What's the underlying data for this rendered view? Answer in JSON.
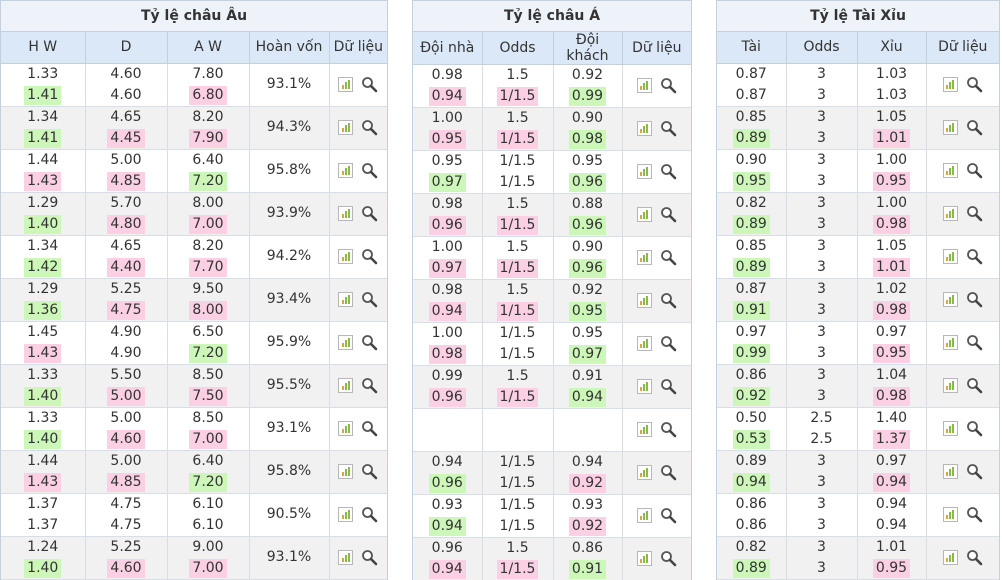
{
  "colors": {
    "up": "#ccf7b8",
    "down": "#fcd0e4",
    "header": "#dbe8f7",
    "alt_row": "#f1f1f1"
  },
  "icons": {
    "data": "bar-chart-icon",
    "detail": "magnifier-icon"
  },
  "europe": {
    "title": "Tỷ lệ châu Âu",
    "headers": [
      "H W",
      "D",
      "A W",
      "Hoàn vốn",
      "Dữ liệu"
    ],
    "rows": [
      {
        "hw": [
          "1.33",
          "1.41"
        ],
        "hw_t": [
          "",
          "up"
        ],
        "d": [
          "4.60",
          "4.60"
        ],
        "d_t": [
          "",
          ""
        ],
        "aw": [
          "7.80",
          "6.80"
        ],
        "aw_t": [
          "",
          "down"
        ],
        "ret": "93.1%"
      },
      {
        "hw": [
          "1.34",
          "1.41"
        ],
        "hw_t": [
          "",
          "up"
        ],
        "d": [
          "4.65",
          "4.45"
        ],
        "d_t": [
          "",
          "down"
        ],
        "aw": [
          "8.20",
          "7.90"
        ],
        "aw_t": [
          "",
          "down"
        ],
        "ret": "94.3%"
      },
      {
        "hw": [
          "1.44",
          "1.43"
        ],
        "hw_t": [
          "",
          "down"
        ],
        "d": [
          "5.00",
          "4.85"
        ],
        "d_t": [
          "",
          "down"
        ],
        "aw": [
          "6.40",
          "7.20"
        ],
        "aw_t": [
          "",
          "up"
        ],
        "ret": "95.8%"
      },
      {
        "hw": [
          "1.29",
          "1.40"
        ],
        "hw_t": [
          "",
          "up"
        ],
        "d": [
          "5.70",
          "4.80"
        ],
        "d_t": [
          "",
          "down"
        ],
        "aw": [
          "8.00",
          "7.00"
        ],
        "aw_t": [
          "",
          "down"
        ],
        "ret": "93.9%"
      },
      {
        "hw": [
          "1.34",
          "1.42"
        ],
        "hw_t": [
          "",
          "up"
        ],
        "d": [
          "4.65",
          "4.40"
        ],
        "d_t": [
          "",
          "down"
        ],
        "aw": [
          "8.20",
          "7.70"
        ],
        "aw_t": [
          "",
          "down"
        ],
        "ret": "94.2%"
      },
      {
        "hw": [
          "1.29",
          "1.36"
        ],
        "hw_t": [
          "",
          "up"
        ],
        "d": [
          "5.25",
          "4.75"
        ],
        "d_t": [
          "",
          "down"
        ],
        "aw": [
          "9.50",
          "8.00"
        ],
        "aw_t": [
          "",
          "down"
        ],
        "ret": "93.4%"
      },
      {
        "hw": [
          "1.45",
          "1.43"
        ],
        "hw_t": [
          "",
          "down"
        ],
        "d": [
          "4.90",
          "4.90"
        ],
        "d_t": [
          "",
          ""
        ],
        "aw": [
          "6.50",
          "7.20"
        ],
        "aw_t": [
          "",
          "up"
        ],
        "ret": "95.9%"
      },
      {
        "hw": [
          "1.33",
          "1.40"
        ],
        "hw_t": [
          "",
          "up"
        ],
        "d": [
          "5.50",
          "5.00"
        ],
        "d_t": [
          "",
          "down"
        ],
        "aw": [
          "8.50",
          "7.50"
        ],
        "aw_t": [
          "",
          "down"
        ],
        "ret": "95.5%"
      },
      {
        "hw": [
          "1.33",
          "1.40"
        ],
        "hw_t": [
          "",
          "up"
        ],
        "d": [
          "5.00",
          "4.60"
        ],
        "d_t": [
          "",
          "down"
        ],
        "aw": [
          "8.50",
          "7.00"
        ],
        "aw_t": [
          "",
          "down"
        ],
        "ret": "93.1%"
      },
      {
        "hw": [
          "1.44",
          "1.43"
        ],
        "hw_t": [
          "",
          "down"
        ],
        "d": [
          "5.00",
          "4.85"
        ],
        "d_t": [
          "",
          "down"
        ],
        "aw": [
          "6.40",
          "7.20"
        ],
        "aw_t": [
          "",
          "up"
        ],
        "ret": "95.8%"
      },
      {
        "hw": [
          "1.37",
          "1.37"
        ],
        "hw_t": [
          "",
          ""
        ],
        "d": [
          "4.75",
          "4.75"
        ],
        "d_t": [
          "",
          ""
        ],
        "aw": [
          "6.10",
          "6.10"
        ],
        "aw_t": [
          "",
          ""
        ],
        "ret": "90.5%"
      },
      {
        "hw": [
          "1.24",
          "1.40"
        ],
        "hw_t": [
          "",
          "up"
        ],
        "d": [
          "5.25",
          "4.60"
        ],
        "d_t": [
          "",
          "down"
        ],
        "aw": [
          "9.00",
          "7.00"
        ],
        "aw_t": [
          "",
          "down"
        ],
        "ret": "93.1%"
      }
    ]
  },
  "asia": {
    "title": "Tỷ lệ châu Á",
    "headers": [
      "Đội nhà",
      "Odds",
      "Đội khách",
      "Dữ liệu"
    ],
    "rows": [
      {
        "home": [
          "0.98",
          "0.94"
        ],
        "home_t": [
          "",
          "down"
        ],
        "odds": [
          "1.5",
          "1/1.5"
        ],
        "odds_t": [
          "",
          "down"
        ],
        "away": [
          "0.92",
          "0.99"
        ],
        "away_t": [
          "",
          "up"
        ]
      },
      {
        "home": [
          "1.00",
          "0.95"
        ],
        "home_t": [
          "",
          "down"
        ],
        "odds": [
          "1.5",
          "1/1.5"
        ],
        "odds_t": [
          "",
          "down"
        ],
        "away": [
          "0.90",
          "0.98"
        ],
        "away_t": [
          "",
          "up"
        ]
      },
      {
        "home": [
          "0.95",
          "0.97"
        ],
        "home_t": [
          "",
          "up"
        ],
        "odds": [
          "1/1.5",
          "1/1.5"
        ],
        "odds_t": [
          "",
          ""
        ],
        "away": [
          "0.95",
          "0.96"
        ],
        "away_t": [
          "",
          "up"
        ]
      },
      {
        "home": [
          "0.98",
          "0.96"
        ],
        "home_t": [
          "",
          "down"
        ],
        "odds": [
          "1.5",
          "1/1.5"
        ],
        "odds_t": [
          "",
          "down"
        ],
        "away": [
          "0.88",
          "0.96"
        ],
        "away_t": [
          "",
          "up"
        ]
      },
      {
        "home": [
          "1.00",
          "0.97"
        ],
        "home_t": [
          "",
          "down"
        ],
        "odds": [
          "1.5",
          "1/1.5"
        ],
        "odds_t": [
          "",
          "down"
        ],
        "away": [
          "0.90",
          "0.96"
        ],
        "away_t": [
          "",
          "up"
        ]
      },
      {
        "home": [
          "0.98",
          "0.94"
        ],
        "home_t": [
          "",
          "down"
        ],
        "odds": [
          "1.5",
          "1/1.5"
        ],
        "odds_t": [
          "",
          "down"
        ],
        "away": [
          "0.92",
          "0.95"
        ],
        "away_t": [
          "",
          "up"
        ]
      },
      {
        "home": [
          "1.00",
          "0.98"
        ],
        "home_t": [
          "",
          "down"
        ],
        "odds": [
          "1/1.5",
          "1/1.5"
        ],
        "odds_t": [
          "",
          ""
        ],
        "away": [
          "0.95",
          "0.97"
        ],
        "away_t": [
          "",
          "up"
        ]
      },
      {
        "home": [
          "0.99",
          "0.96"
        ],
        "home_t": [
          "",
          "down"
        ],
        "odds": [
          "1.5",
          "1/1.5"
        ],
        "odds_t": [
          "",
          "down"
        ],
        "away": [
          "0.91",
          "0.94"
        ],
        "away_t": [
          "",
          "up"
        ]
      },
      {
        "home": [
          "",
          ""
        ],
        "home_t": [
          "",
          ""
        ],
        "odds": [
          "",
          ""
        ],
        "odds_t": [
          "",
          ""
        ],
        "away": [
          "",
          ""
        ],
        "away_t": [
          "",
          ""
        ]
      },
      {
        "home": [
          "0.94",
          "0.96"
        ],
        "home_t": [
          "",
          "up"
        ],
        "odds": [
          "1/1.5",
          "1/1.5"
        ],
        "odds_t": [
          "",
          ""
        ],
        "away": [
          "0.94",
          "0.92"
        ],
        "away_t": [
          "",
          "down"
        ]
      },
      {
        "home": [
          "0.93",
          "0.94"
        ],
        "home_t": [
          "",
          "up"
        ],
        "odds": [
          "1/1.5",
          "1/1.5"
        ],
        "odds_t": [
          "",
          ""
        ],
        "away": [
          "0.93",
          "0.92"
        ],
        "away_t": [
          "",
          "down"
        ]
      },
      {
        "home": [
          "0.96",
          "0.94"
        ],
        "home_t": [
          "",
          "down"
        ],
        "odds": [
          "1.5",
          "1/1.5"
        ],
        "odds_t": [
          "",
          "down"
        ],
        "away": [
          "0.86",
          "0.91"
        ],
        "away_t": [
          "",
          "up"
        ]
      }
    ]
  },
  "overunder": {
    "title": "Tỷ lệ Tài Xỉu",
    "headers": [
      "Tài",
      "Odds",
      "Xỉu",
      "Dữ liệu"
    ],
    "rows": [
      {
        "over": [
          "0.87",
          "0.87"
        ],
        "over_t": [
          "",
          ""
        ],
        "odds": [
          "3",
          "3"
        ],
        "odds_t": [
          "",
          ""
        ],
        "under": [
          "1.03",
          "1.03"
        ],
        "under_t": [
          "",
          ""
        ]
      },
      {
        "over": [
          "0.85",
          "0.89"
        ],
        "over_t": [
          "",
          "up"
        ],
        "odds": [
          "3",
          "3"
        ],
        "odds_t": [
          "",
          ""
        ],
        "under": [
          "1.05",
          "1.01"
        ],
        "under_t": [
          "",
          "down"
        ]
      },
      {
        "over": [
          "0.90",
          "0.95"
        ],
        "over_t": [
          "",
          "up"
        ],
        "odds": [
          "3",
          "3"
        ],
        "odds_t": [
          "",
          ""
        ],
        "under": [
          "1.00",
          "0.95"
        ],
        "under_t": [
          "",
          "down"
        ]
      },
      {
        "over": [
          "0.82",
          "0.89"
        ],
        "over_t": [
          "",
          "up"
        ],
        "odds": [
          "3",
          "3"
        ],
        "odds_t": [
          "",
          ""
        ],
        "under": [
          "1.00",
          "0.98"
        ],
        "under_t": [
          "",
          "down"
        ]
      },
      {
        "over": [
          "0.85",
          "0.89"
        ],
        "over_t": [
          "",
          "up"
        ],
        "odds": [
          "3",
          "3"
        ],
        "odds_t": [
          "",
          ""
        ],
        "under": [
          "1.05",
          "1.01"
        ],
        "under_t": [
          "",
          "down"
        ]
      },
      {
        "over": [
          "0.87",
          "0.91"
        ],
        "over_t": [
          "",
          "up"
        ],
        "odds": [
          "3",
          "3"
        ],
        "odds_t": [
          "",
          ""
        ],
        "under": [
          "1.02",
          "0.98"
        ],
        "under_t": [
          "",
          "down"
        ]
      },
      {
        "over": [
          "0.97",
          "0.99"
        ],
        "over_t": [
          "",
          "up"
        ],
        "odds": [
          "3",
          "3"
        ],
        "odds_t": [
          "",
          ""
        ],
        "under": [
          "0.97",
          "0.95"
        ],
        "under_t": [
          "",
          "down"
        ]
      },
      {
        "over": [
          "0.86",
          "0.92"
        ],
        "over_t": [
          "",
          "up"
        ],
        "odds": [
          "3",
          "3"
        ],
        "odds_t": [
          "",
          ""
        ],
        "under": [
          "1.04",
          "0.98"
        ],
        "under_t": [
          "",
          "down"
        ]
      },
      {
        "over": [
          "0.50",
          "0.53"
        ],
        "over_t": [
          "",
          "up"
        ],
        "odds": [
          "2.5",
          "2.5"
        ],
        "odds_t": [
          "",
          ""
        ],
        "under": [
          "1.40",
          "1.37"
        ],
        "under_t": [
          "",
          "down"
        ]
      },
      {
        "over": [
          "0.89",
          "0.94"
        ],
        "over_t": [
          "",
          "up"
        ],
        "odds": [
          "3",
          "3"
        ],
        "odds_t": [
          "",
          ""
        ],
        "under": [
          "0.97",
          "0.94"
        ],
        "under_t": [
          "",
          "down"
        ]
      },
      {
        "over": [
          "0.86",
          "0.86"
        ],
        "over_t": [
          "",
          ""
        ],
        "odds": [
          "3",
          "3"
        ],
        "odds_t": [
          "",
          ""
        ],
        "under": [
          "0.94",
          "0.94"
        ],
        "under_t": [
          "",
          ""
        ]
      },
      {
        "over": [
          "0.82",
          "0.89"
        ],
        "over_t": [
          "",
          "up"
        ],
        "odds": [
          "3",
          "3"
        ],
        "odds_t": [
          "",
          ""
        ],
        "under": [
          "1.01",
          "0.95"
        ],
        "under_t": [
          "",
          "down"
        ]
      }
    ]
  }
}
